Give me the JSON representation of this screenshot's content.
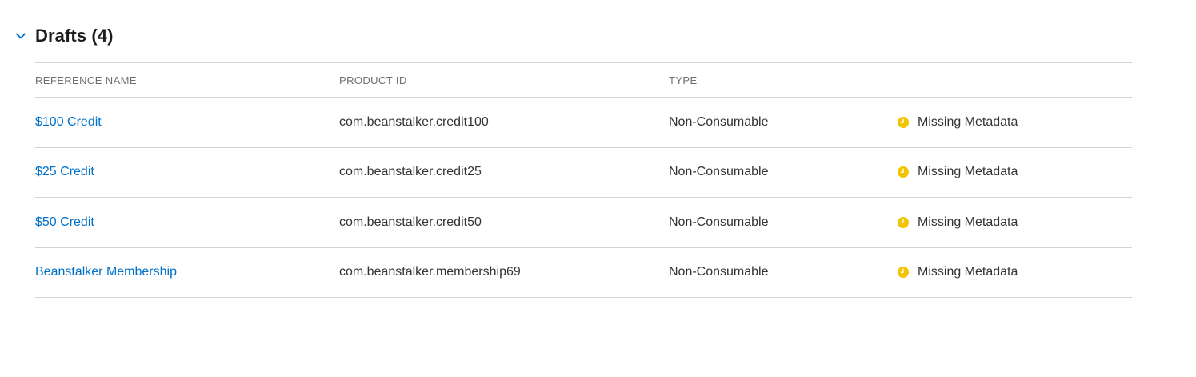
{
  "section": {
    "title": "Drafts (4)",
    "expanded": true
  },
  "table": {
    "columns": [
      "REFERENCE NAME",
      "PRODUCT ID",
      "TYPE",
      ""
    ],
    "rows": [
      {
        "reference_name": "$100 Credit",
        "product_id": "com.beanstalker.credit100",
        "type": "Non-Consumable",
        "status": "Missing Metadata"
      },
      {
        "reference_name": "$25 Credit",
        "product_id": "com.beanstalker.credit25",
        "type": "Non-Consumable",
        "status": "Missing Metadata"
      },
      {
        "reference_name": "$50 Credit",
        "product_id": "com.beanstalker.credit50",
        "type": "Non-Consumable",
        "status": "Missing Metadata"
      },
      {
        "reference_name": "Beanstalker Membership",
        "product_id": "com.beanstalker.membership69",
        "type": "Non-Consumable",
        "status": "Missing Metadata"
      }
    ]
  },
  "colors": {
    "link": "#0070c9",
    "status_warning": "#f5c400",
    "divider": "#d2d2d7",
    "chevron": "#0070c9"
  },
  "icons": {
    "section_toggle": "chevron-down-icon",
    "status": "clock-status-icon"
  }
}
